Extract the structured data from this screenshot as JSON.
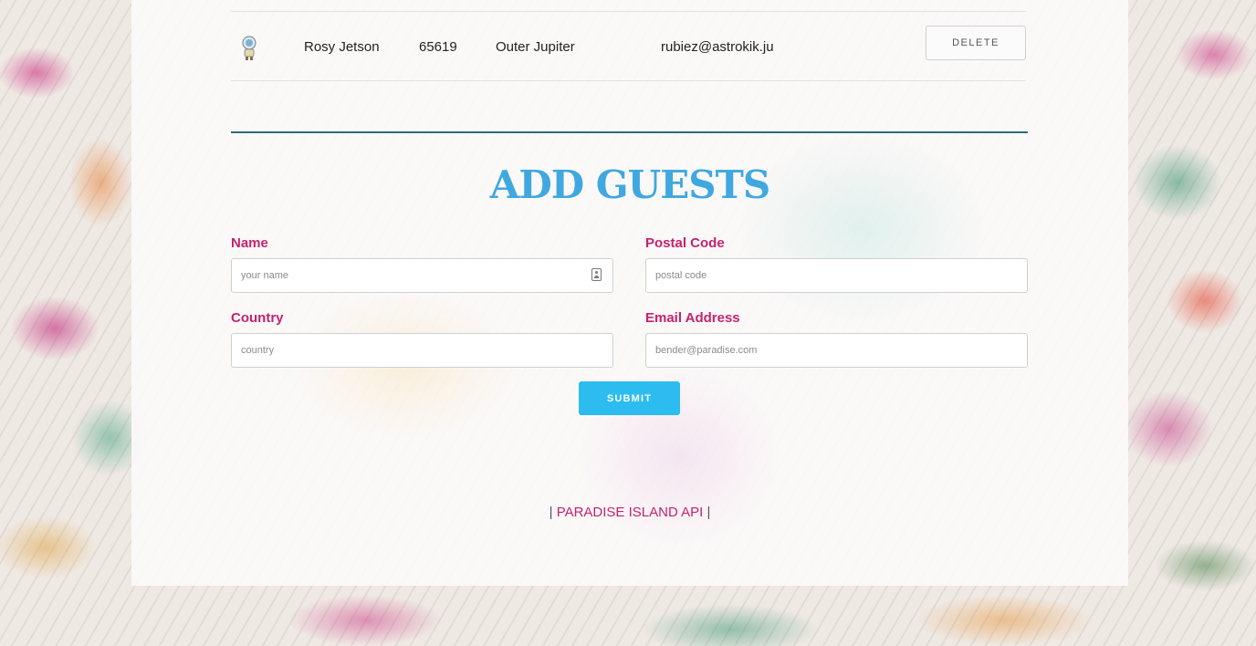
{
  "guest_list": {
    "rows": [
      {
        "avatar_icon": "astronaut-icon",
        "name": "Rosy Jetson",
        "postal_code": "65619",
        "country": "Outer Jupiter",
        "email": "rubiez@astrokik.ju",
        "delete_label": "DELETE"
      }
    ]
  },
  "add_guests": {
    "title": "ADD GUESTS",
    "name_label": "Name",
    "name_placeholder": "your name",
    "postal_label": "Postal Code",
    "postal_placeholder": "postal code",
    "country_label": "Country",
    "country_placeholder": "country",
    "email_label": "Email Address",
    "email_placeholder": "bender@paradise.com",
    "submit_label": "SUBMIT"
  },
  "footer": {
    "left_pipe": "|",
    "text": "PARADISE ISLAND API",
    "right_pipe": "|"
  },
  "colors": {
    "title": "#3fa8e0",
    "label": "#c4236e",
    "submit": "#2cbcef",
    "divider": "#2a6f75"
  }
}
